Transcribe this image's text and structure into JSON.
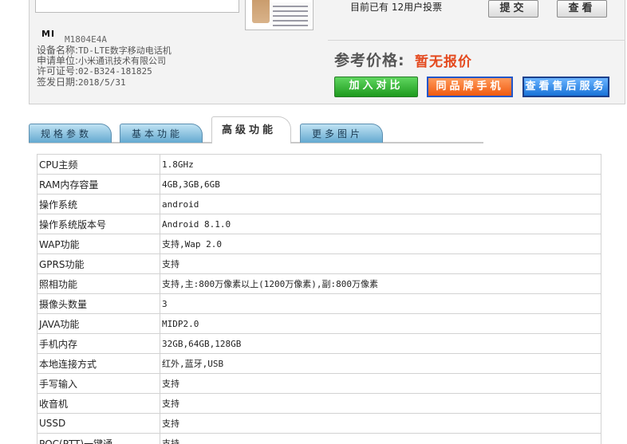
{
  "device": {
    "brand_logo": "MI",
    "model": "M1804E4A",
    "fields": [
      {
        "label": "设备名称:",
        "value": "TD-LTE数字移动电话机"
      },
      {
        "label": "申请单位:",
        "value": "小米通讯技术有限公司"
      },
      {
        "label": "许可证号:",
        "value": "02-B324-181825"
      },
      {
        "label": "签发日期:",
        "value": "2018/5/31"
      }
    ]
  },
  "vote": {
    "text": "目前已有 12用户投票",
    "submit_label": "提交",
    "view_label": "查看"
  },
  "price": {
    "label": "参考价格:",
    "value": "暂无报价"
  },
  "actions": {
    "compare_label": "加入对比",
    "same_brand_label": "同品牌手机",
    "after_sales_label": "查看售后服务"
  },
  "tabs": [
    {
      "label": "规格参数",
      "active": false
    },
    {
      "label": "基本功能",
      "active": false
    },
    {
      "label": "高级功能",
      "active": true
    },
    {
      "label": "更多图片",
      "active": false
    }
  ],
  "specs": [
    {
      "key": "CPU主频",
      "value": "1.8GHz"
    },
    {
      "key": "RAM内存容量",
      "value": "4GB,3GB,6GB"
    },
    {
      "key": "操作系统",
      "value": "android"
    },
    {
      "key": "操作系统版本号",
      "value": "Android 8.1.0"
    },
    {
      "key": "WAP功能",
      "value": "支持,Wap 2.0"
    },
    {
      "key": "GPRS功能",
      "value": "支持"
    },
    {
      "key": "照相功能",
      "value": "支持,主:800万像素以上(1200万像素),副:800万像素"
    },
    {
      "key": "摄像头数量",
      "value": "3"
    },
    {
      "key": "JAVA功能",
      "value": "MIDP2.0"
    },
    {
      "key": "手机内存",
      "value": "32GB,64GB,128GB"
    },
    {
      "key": "本地连接方式",
      "value": "红外,蓝牙,USB"
    },
    {
      "key": "手写输入",
      "value": "支持"
    },
    {
      "key": "收音机",
      "value": "支持"
    },
    {
      "key": "USSD",
      "value": "支持"
    },
    {
      "key": "POC(PTT)一键通",
      "value": "支持"
    }
  ],
  "colors": {
    "price_accent": "#e4491e",
    "tab_blue": "#64a9d0",
    "btn_green": "#1e9a1e",
    "btn_orange": "#f05a10",
    "btn_blue": "#1872d8"
  }
}
